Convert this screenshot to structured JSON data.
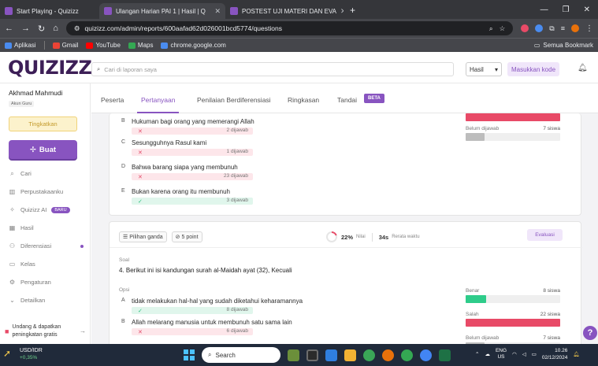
{
  "browser": {
    "tabs": [
      {
        "title": "Start Playing - Quizizz",
        "active": false
      },
      {
        "title": "Ulangan Harian PAI 1 | Hasil | Q",
        "active": true
      },
      {
        "title": "POSTEST UJI MATERI DAN EVA",
        "active": false
      }
    ],
    "url": "quizizz.com/admin/reports/600aafad62d026001bcd5774/questions",
    "bookmarks": [
      "Aplikasi",
      "Gmail",
      "YouTube",
      "Maps",
      "chrome.google.com"
    ],
    "all_bookmarks": "Semua Bookmark"
  },
  "header": {
    "logo": "QUIZIZZ",
    "search_placeholder": "Cari di laporan saya",
    "report_select": "Hasil",
    "join_code_label": "Masukkan kode"
  },
  "sidebar": {
    "user_name": "Akhmad Mahmudi",
    "user_role": "Akun Guru",
    "upgrade_label": "Tingkatkan",
    "create_label": "Buat",
    "menu": [
      {
        "label": "Cari",
        "icon": "search-icon"
      },
      {
        "label": "Perpustakaanku",
        "icon": "library-icon"
      },
      {
        "label": "Quizizz AI",
        "icon": "sparkle-icon",
        "badge": "BARU"
      },
      {
        "label": "Hasil",
        "icon": "chart-icon"
      },
      {
        "label": "Diferensiasi",
        "icon": "people-icon",
        "dot": true
      },
      {
        "label": "Kelas",
        "icon": "class-icon"
      },
      {
        "label": "Pengaturan",
        "icon": "gear-icon"
      },
      {
        "label": "Detailkan",
        "icon": "chevron-down-icon"
      }
    ],
    "promo_line1": "Undang & dapatkan",
    "promo_line2": "peningkatan gratis"
  },
  "subtabs": [
    "Peserta",
    "Pertanyaan",
    "Penilaian Berdiferensiasi",
    "Ringkasan",
    "Tandai"
  ],
  "active_subtab": "Pertanyaan",
  "beta_badge": "BETA",
  "question3": {
    "options": [
      {
        "letter": "B",
        "text": "Hukuman bagi orang yang memerangi Allah",
        "correct": false,
        "count": "2 dijawab"
      },
      {
        "letter": "C",
        "text": "Sesungguhnya Rasul kami",
        "correct": false,
        "count": "1 dijawab"
      },
      {
        "letter": "D",
        "text": "Bahwa barang siapa yang membunuh",
        "correct": false,
        "count": "23 dijawab"
      },
      {
        "letter": "E",
        "text": "Bukan karena orang itu membunuh",
        "correct": true,
        "count": "3 dijawab"
      }
    ],
    "stats": [
      {
        "label": "",
        "value": "",
        "color": "#e84a67",
        "fraction": 1.0
      },
      {
        "label": "Belum dijawab",
        "value": "7 siswa",
        "color": "#bdbdbd",
        "fraction": 0.2
      }
    ]
  },
  "question4": {
    "type_label": "Pilihan ganda",
    "points_label": "5 point",
    "accuracy": "22%",
    "accuracy_label": "Nilai",
    "avg_time": "34s",
    "avg_time_label": "Rerata waktu",
    "evaluate_label": "Evaluasi",
    "soal_label": "Soal",
    "text": "4. Berikut ini isi kandungan surah al-Maidah ayat (32), Kecuali",
    "opsi_label": "Opsi",
    "options": [
      {
        "letter": "A",
        "text": "tidak melakukan hal-hal yang sudah diketahui keharamannya",
        "correct": true,
        "count": "8 dijawab"
      },
      {
        "letter": "B",
        "text": "Allah melarang manusia untuk membunuh satu sama lain",
        "correct": false,
        "count": "6 dijawab"
      }
    ],
    "stats": [
      {
        "label": "Benar",
        "value": "8 siswa",
        "color": "#2ecc8a",
        "fraction": 0.22
      },
      {
        "label": "Salah",
        "value": "22 siswa",
        "color": "#e84a67",
        "fraction": 1.0
      },
      {
        "label": "Belum dijawab",
        "value": "7 siswa",
        "color": "#bdbdbd",
        "fraction": 0.2
      }
    ]
  },
  "taskbar": {
    "ticker_name": "USD/IDR",
    "ticker_change": "+0,35%",
    "search_label": "Search",
    "lang_top": "ENG",
    "lang_bottom": "US",
    "time": "10.26",
    "date": "02/12/2024"
  }
}
